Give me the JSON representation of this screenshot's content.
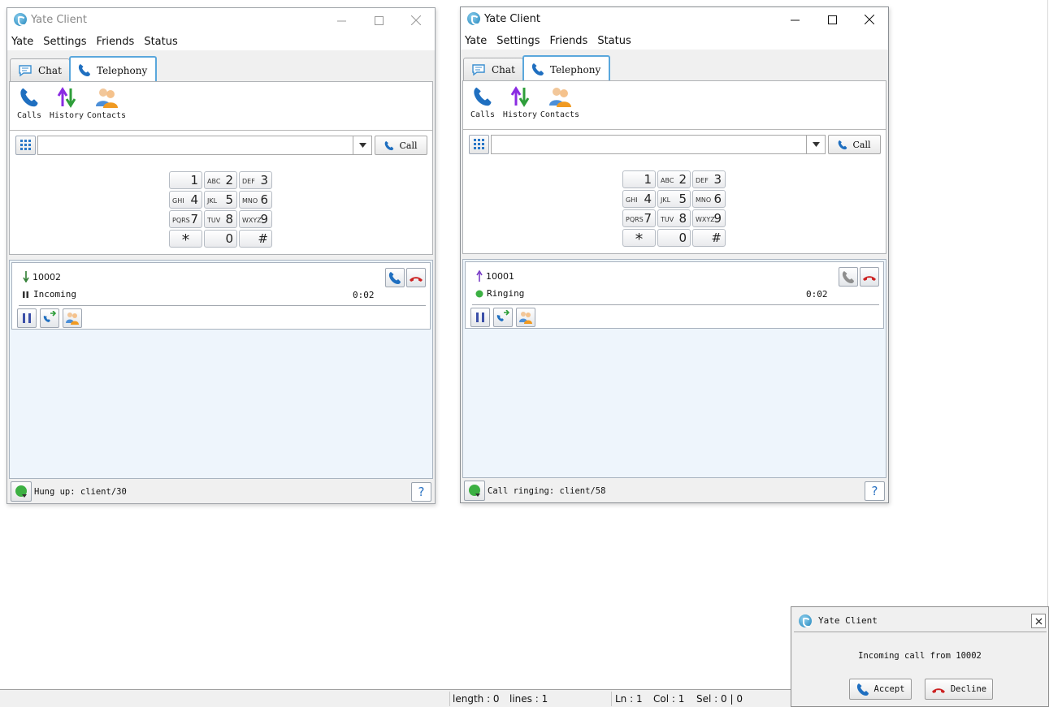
{
  "colors": {
    "accent": "#5aa7dc",
    "answer": "#1f6fc0",
    "hangup": "#cc2222",
    "ringing": "#3cb043",
    "panel_bg": "#eef5fc"
  },
  "windows": [
    {
      "title": "Yate Client",
      "menu": [
        "Yate",
        "Settings",
        "Friends",
        "Status"
      ],
      "tabs": {
        "chat": "Chat",
        "telephony": "Telephony"
      },
      "toolbar": {
        "calls": "Calls",
        "history": "History",
        "contacts": "Contacts"
      },
      "number_input": "",
      "call_button": "Call",
      "call": {
        "direction": "incoming",
        "number": "10002",
        "status": "Incoming",
        "status_icon": "pause-icon",
        "duration": "0:02",
        "answer_enabled": true
      },
      "status_text": "Hung up: client/30",
      "help": "?"
    },
    {
      "title": "Yate Client",
      "menu": [
        "Yate",
        "Settings",
        "Friends",
        "Status"
      ],
      "tabs": {
        "chat": "Chat",
        "telephony": "Telephony"
      },
      "toolbar": {
        "calls": "Calls",
        "history": "History",
        "contacts": "Contacts"
      },
      "number_input": "",
      "call_button": "Call",
      "call": {
        "direction": "outgoing",
        "number": "10001",
        "status": "Ringing",
        "status_icon": "ringing-dot-icon",
        "duration": "0:02",
        "answer_enabled": false
      },
      "status_text": "Call ringing: client/58",
      "help": "?"
    }
  ],
  "keypad": [
    {
      "digit": "1",
      "letters": ""
    },
    {
      "digit": "2",
      "letters": "ABC"
    },
    {
      "digit": "3",
      "letters": "DEF"
    },
    {
      "digit": "4",
      "letters": "GHI"
    },
    {
      "digit": "5",
      "letters": "JKL"
    },
    {
      "digit": "6",
      "letters": "MNO"
    },
    {
      "digit": "7",
      "letters": "PQRS"
    },
    {
      "digit": "8",
      "letters": "TUV"
    },
    {
      "digit": "9",
      "letters": "WXYZ"
    },
    {
      "digit": "*",
      "letters": ""
    },
    {
      "digit": "0",
      "letters": ""
    },
    {
      "digit": "#",
      "letters": ""
    }
  ],
  "editor_status": {
    "length": "length : 0",
    "lines": "lines : 1",
    "ln": "Ln : 1",
    "col": "Col : 1",
    "sel": "Sel : 0 | 0"
  },
  "notification": {
    "title": "Yate Client",
    "message": "Incoming call from 10002",
    "accept": "Accept",
    "decline": "Decline"
  }
}
